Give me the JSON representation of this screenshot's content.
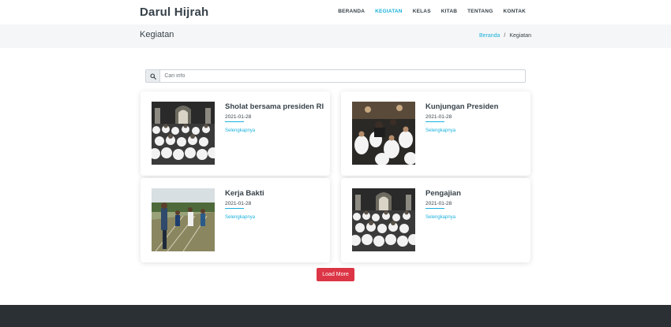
{
  "nav": {
    "brand": "Darul Hijrah",
    "items": [
      {
        "label": "BERANDA",
        "active": false
      },
      {
        "label": "KEGIATAN",
        "active": true
      },
      {
        "label": "KELAS",
        "active": false
      },
      {
        "label": "KITAB",
        "active": false
      },
      {
        "label": "TENTANG",
        "active": false
      },
      {
        "label": "KONTAK",
        "active": false
      }
    ]
  },
  "header": {
    "title": "Kegiatan",
    "breadcrumb": {
      "home": "Beranda",
      "separator": "/",
      "current": "Kegiatan"
    }
  },
  "search": {
    "placeholder": "Cari info",
    "icon": "search-icon"
  },
  "cards": [
    {
      "title": "Sholat bersama presiden RI",
      "date": "2021-01-28",
      "link": "Selengkapnya",
      "image": "mosque-congregation-photo"
    },
    {
      "title": "Kunjungan Presiden",
      "date": "2021-01-28",
      "link": "Selengkapnya",
      "image": "president-visit-photo"
    },
    {
      "title": "Kerja Bakti",
      "date": "2021-01-28",
      "link": "Selengkapnya",
      "image": "community-work-photo"
    },
    {
      "title": "Pengajian",
      "date": "2021-01-28",
      "link": "Selengkapnya",
      "image": "mosque-congregation-photo"
    }
  ],
  "load_more": "Load More",
  "colors": {
    "accent": "#1bb1dc",
    "button": "#dc3545",
    "footer": "#2b3035",
    "titlebar": "#f5f6f7"
  }
}
